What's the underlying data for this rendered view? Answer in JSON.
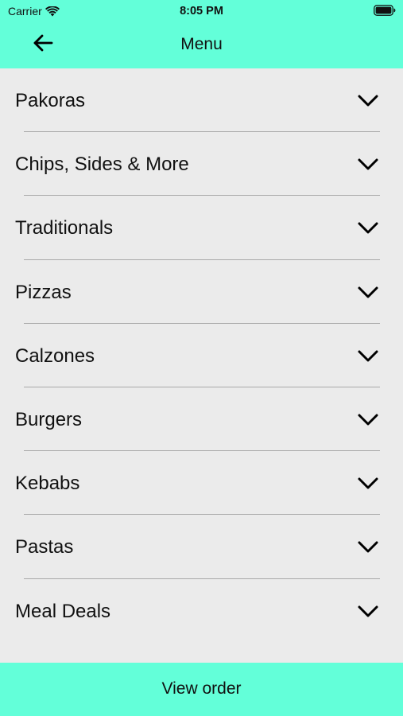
{
  "status_bar": {
    "carrier": "Carrier",
    "time": "8:05 PM"
  },
  "nav": {
    "title": "Menu",
    "back_icon": "arrow-left-icon"
  },
  "menu": {
    "items": [
      {
        "label": "Pakoras"
      },
      {
        "label": "Chips, Sides & More"
      },
      {
        "label": "Traditionals"
      },
      {
        "label": "Pizzas"
      },
      {
        "label": "Calzones"
      },
      {
        "label": "Burgers"
      },
      {
        "label": "Kebabs"
      },
      {
        "label": "Pastas"
      },
      {
        "label": "Meal Deals"
      }
    ],
    "expand_icon": "chevron-down-icon"
  },
  "footer": {
    "view_order_label": "View order"
  },
  "colors": {
    "accent": "#63ffd9",
    "background": "#ebebeb",
    "divider": "#a9a9a9"
  }
}
